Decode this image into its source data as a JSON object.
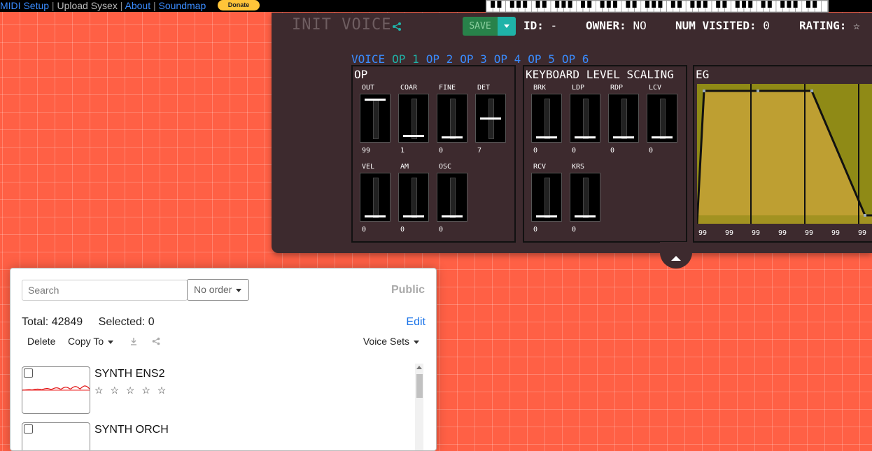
{
  "nav": {
    "links": [
      "MIDI Setup",
      "Upload Sysex",
      "About",
      "Soundmap"
    ],
    "donate": "Donate"
  },
  "editor": {
    "voice_name": "INIT VOICE",
    "save_label": "SAVE",
    "id_label": "ID:",
    "id_value": "-",
    "owner_label": "OWNER:",
    "owner_value": "NO",
    "visited_label": "NUM VISITED:",
    "visited_value": "0",
    "rating_label": "RATING:",
    "rating_value": "☆",
    "tabs": [
      "VOICE",
      "OP 1",
      "OP 2",
      "OP 3",
      "OP 4",
      "OP 5",
      "OP 6"
    ],
    "active_tab": "OP 1",
    "op_panel": {
      "title": "OP",
      "sliders": [
        {
          "label": "OUT",
          "value": "99",
          "level": 0.99
        },
        {
          "label": "COAR",
          "value": "1",
          "level": 0.03
        },
        {
          "label": "FINE",
          "value": "0",
          "level": 0
        },
        {
          "label": "DET",
          "value": "7",
          "level": 0.5
        },
        {
          "label": "VEL",
          "value": "0",
          "level": 0
        },
        {
          "label": "AM",
          "value": "0",
          "level": 0
        },
        {
          "label": "OSC",
          "value": "0",
          "level": 0
        }
      ]
    },
    "kls_panel": {
      "title": "KEYBOARD LEVEL SCALING",
      "sliders": [
        {
          "label": "BRK",
          "value": "0",
          "level": 0
        },
        {
          "label": "LDP",
          "value": "0",
          "level": 0
        },
        {
          "label": "RDP",
          "value": "0",
          "level": 0
        },
        {
          "label": "LCV",
          "value": "0",
          "level": 0
        },
        {
          "label": "RCV",
          "value": "0",
          "level": 0
        },
        {
          "label": "KRS",
          "value": "0",
          "level": 0
        }
      ]
    },
    "eg_panel": {
      "title": "EG",
      "values": [
        "99",
        "99",
        "99",
        "99",
        "99",
        "99",
        "99"
      ]
    }
  },
  "library": {
    "search_placeholder": "Search",
    "order_label": "No order",
    "public_label": "Public",
    "total_label": "Total: 42849",
    "selected_label": "Selected: 0",
    "edit_label": "Edit",
    "delete_label": "Delete",
    "copy_to_label": "Copy To",
    "voice_sets_label": "Voice Sets",
    "items": [
      {
        "name": "SYNTH ENS2",
        "rating": "☆ ☆ ☆ ☆ ☆"
      },
      {
        "name": "SYNTH ORCH",
        "rating": ""
      }
    ]
  },
  "colors": {
    "background": "#ff6045",
    "editor": "#3d2a2e",
    "accent_blue": "#3a8cff",
    "accent_teal": "#1fb3a8",
    "save_green": "#28824a",
    "eg_fill": "#c9a43a"
  }
}
